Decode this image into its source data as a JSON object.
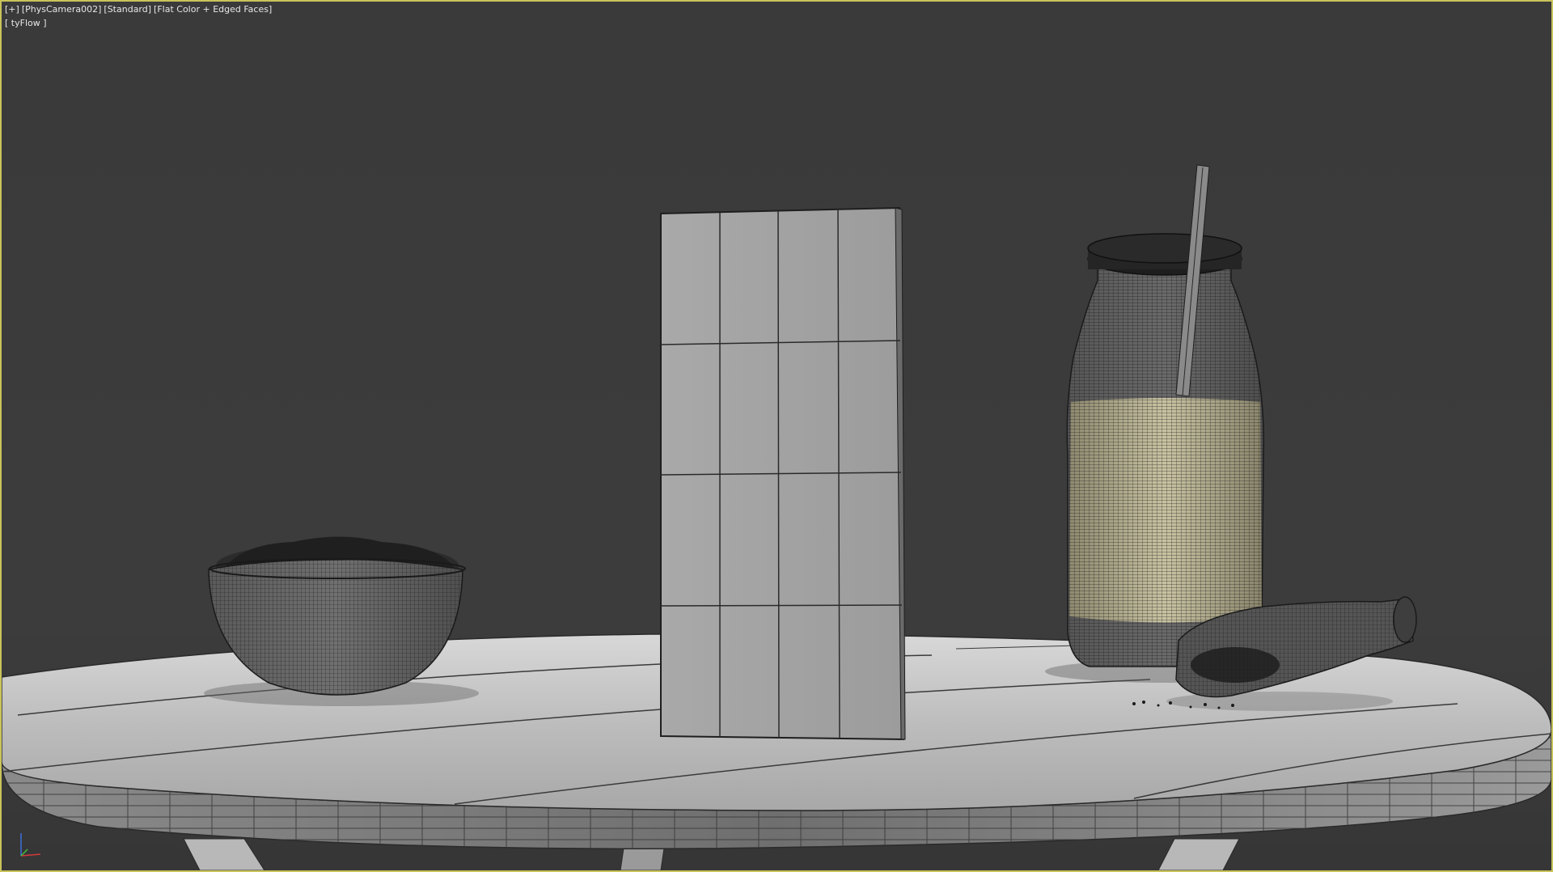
{
  "viewport": {
    "label_plus": "[+]",
    "label_camera": "[PhysCamera002]",
    "label_shading_mode": "[Standard]",
    "label_display": "[Flat Color + Edged Faces]",
    "label_plugin": "[ tyFlow ]",
    "active_border_color": "#c9c25a",
    "background_color": "#3b3b3b"
  },
  "scene_objects": [
    "round-table",
    "bowl",
    "box",
    "milk-jar",
    "straw",
    "scoop"
  ],
  "axis_gizmo": {
    "x_color": "#d23a3a",
    "y_color": "#3fbf3f",
    "z_color": "#3a6fd8"
  }
}
